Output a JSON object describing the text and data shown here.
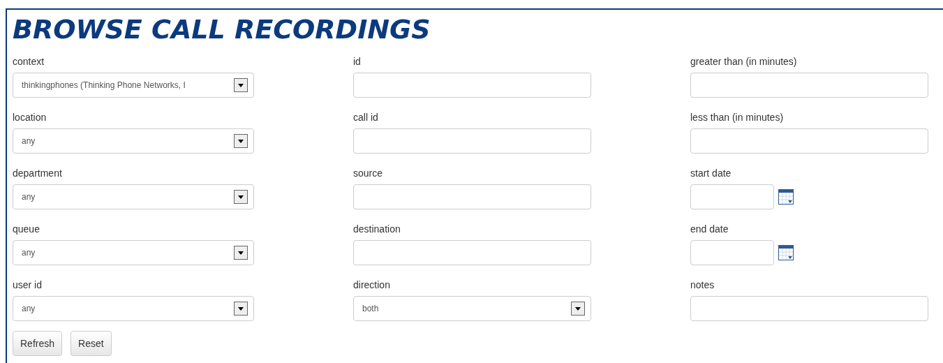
{
  "title": "BROWSE CALL RECORDINGS",
  "columns": [
    [
      {
        "label": "context",
        "kind": "select",
        "value": "thinkingphones (Thinking Phone Networks, I"
      },
      {
        "label": "location",
        "kind": "select",
        "value": "any"
      },
      {
        "label": "department",
        "kind": "select",
        "value": "any"
      },
      {
        "label": "queue",
        "kind": "select",
        "value": "any"
      },
      {
        "label": "user id",
        "kind": "select",
        "value": "any"
      }
    ],
    [
      {
        "label": "id",
        "kind": "text"
      },
      {
        "label": "call id",
        "kind": "text"
      },
      {
        "label": "source",
        "kind": "text"
      },
      {
        "label": "destination",
        "kind": "text"
      },
      {
        "label": "direction",
        "kind": "select",
        "value": "both"
      }
    ],
    [
      {
        "label": "greater than (in minutes)",
        "kind": "text"
      },
      {
        "label": "less than (in minutes)",
        "kind": "text"
      },
      {
        "label": "start date",
        "kind": "date"
      },
      {
        "label": "end date",
        "kind": "date"
      },
      {
        "label": "notes",
        "kind": "text"
      }
    ]
  ],
  "buttons": [
    "Refresh",
    "Reset"
  ]
}
